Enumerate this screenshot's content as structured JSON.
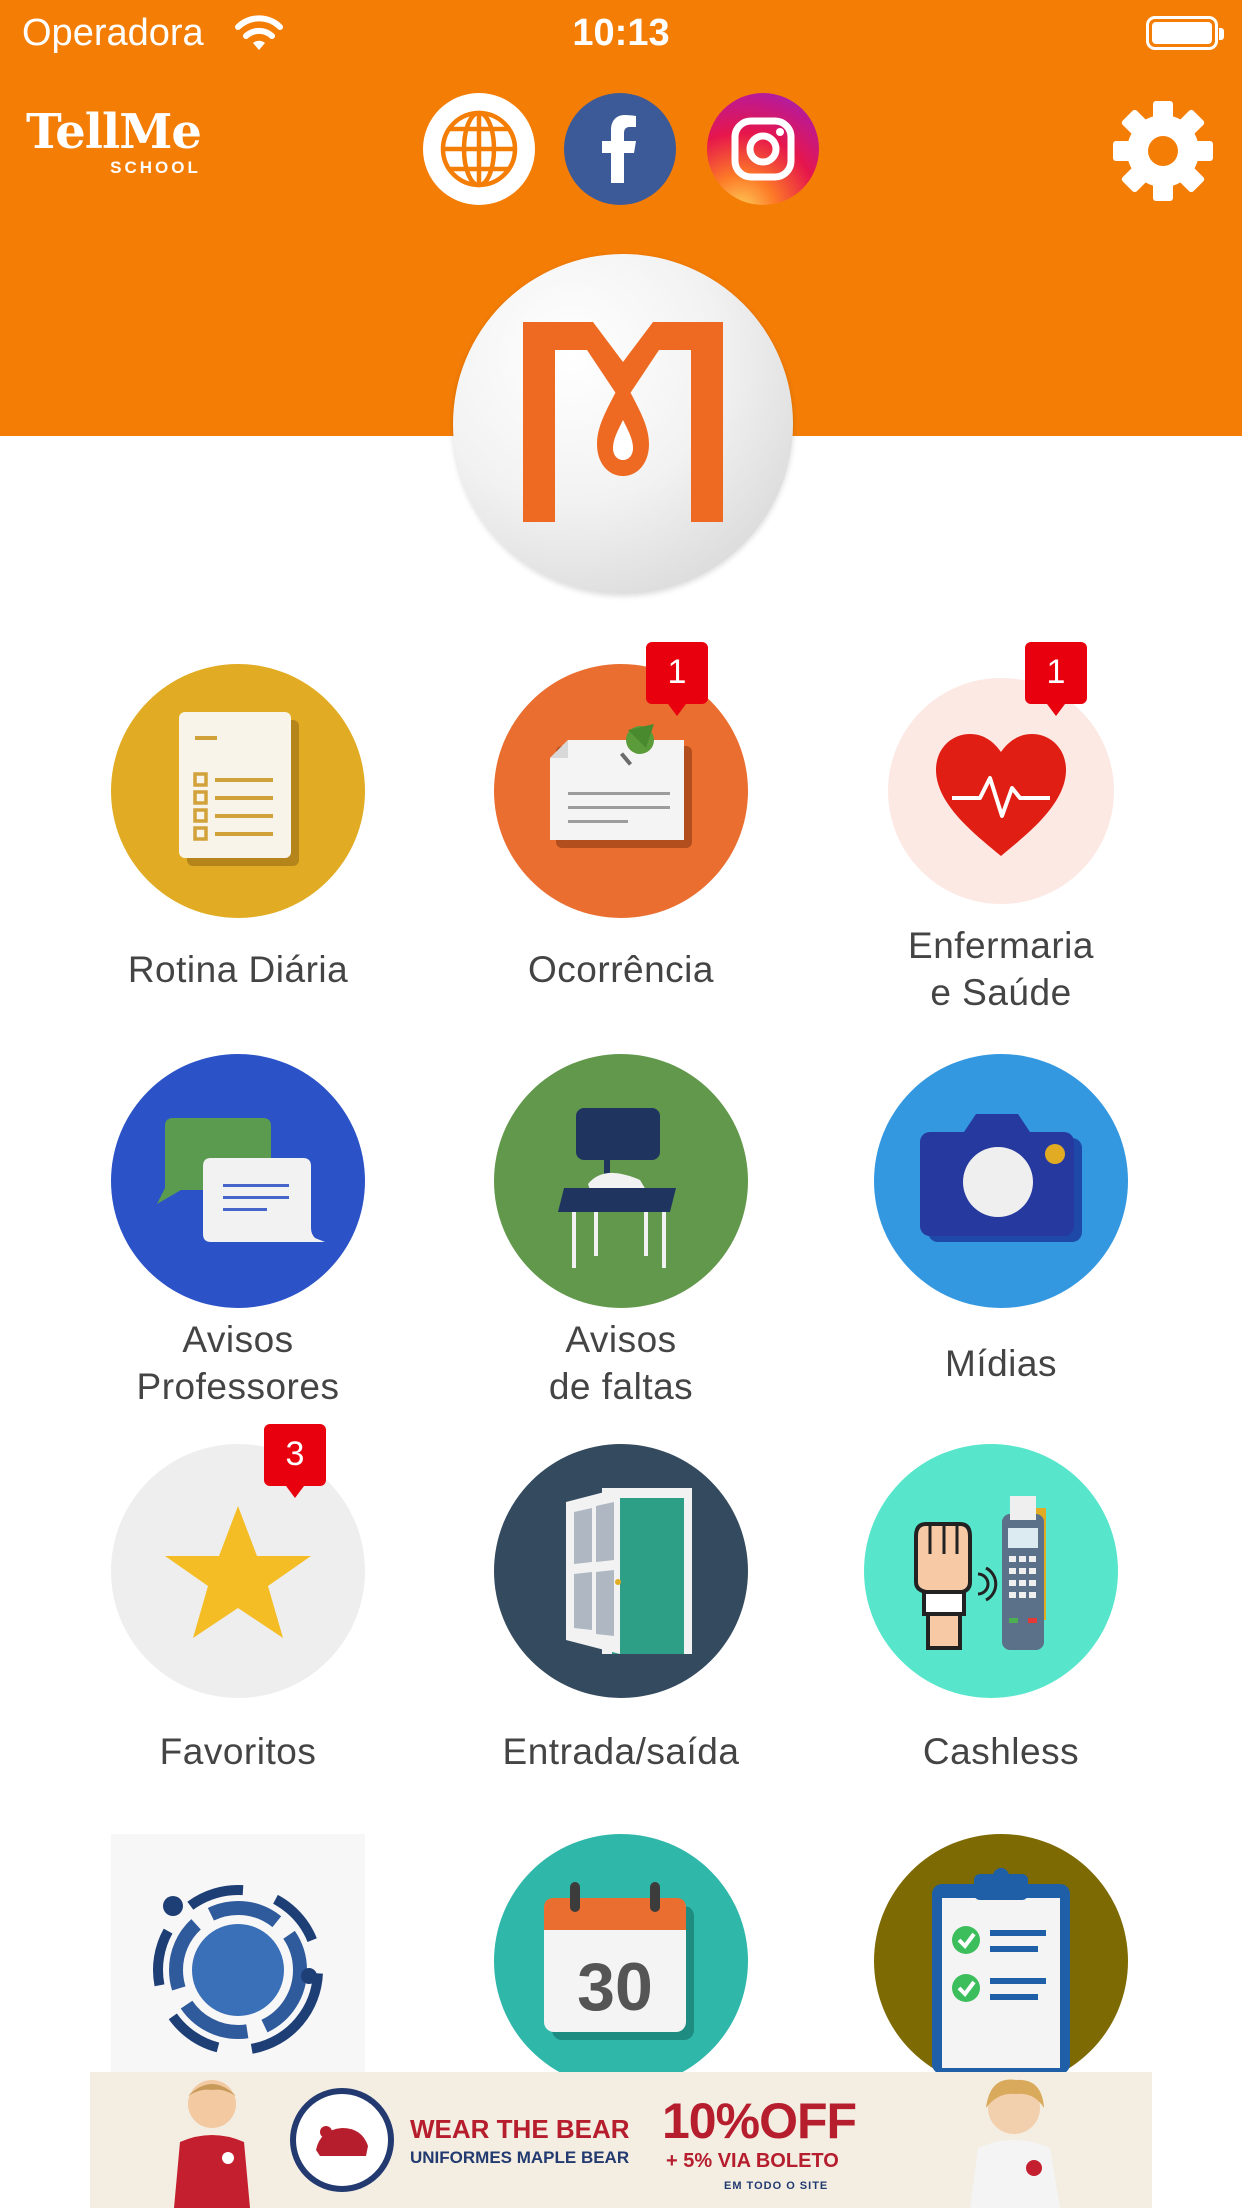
{
  "status_bar": {
    "carrier": "Operadora",
    "time": "10:13"
  },
  "header": {
    "brand_name": "TellMe",
    "brand_sub": "SCHOOL",
    "background_color": "#F47D06",
    "social_links": [
      {
        "name": "website",
        "icon": "globe-icon"
      },
      {
        "name": "facebook",
        "icon": "facebook-icon"
      },
      {
        "name": "instagram",
        "icon": "instagram-icon"
      }
    ],
    "settings_icon": "gear-icon",
    "school_logo": "Maple Bear M logo"
  },
  "tiles": [
    {
      "label_lines": [
        "Rotina Diária"
      ],
      "icon": "checklist-icon",
      "color": "#E1AC23"
    },
    {
      "label_lines": [
        "Ocorrência"
      ],
      "icon": "pinned-note-icon",
      "color": "#E96E30",
      "badge": "1"
    },
    {
      "label_lines": [
        "Enfermaria",
        "e Saúde"
      ],
      "icon": "heart-pulse-icon",
      "color": "#FCE9E4",
      "badge": "1"
    },
    {
      "label_lines": [
        "Avisos",
        "Professores"
      ],
      "icon": "chat-bubbles-icon",
      "color": "#2B53C7"
    },
    {
      "label_lines": [
        "Avisos",
        "de faltas"
      ],
      "icon": "empty-desk-icon",
      "color": "#62984B"
    },
    {
      "label_lines": [
        "Mídias"
      ],
      "icon": "camera-icon",
      "color": "#3498E0"
    },
    {
      "label_lines": [
        "Favoritos"
      ],
      "icon": "star-icon",
      "color": "#EEEEEE",
      "badge": "3"
    },
    {
      "label_lines": [
        "Entrada/saída"
      ],
      "icon": "door-icon",
      "color": "#344A5E"
    },
    {
      "label_lines": [
        "Cashless"
      ],
      "icon": "contactless-payment-icon",
      "color": "#57E6CC"
    },
    {
      "label_lines": [],
      "icon": "circle-logo-icon",
      "color": "#F7F7F7"
    },
    {
      "label_lines": [],
      "icon": "calendar-icon",
      "color": "#2FB7AA",
      "calendar_day": "30"
    },
    {
      "label_lines": [],
      "icon": "clipboard-check-icon",
      "color": "#7D6A02"
    }
  ],
  "ad": {
    "title": "WEAR THE BEAR",
    "subtitle": "UNIFORMES MAPLE BEAR",
    "offer": "10%OFF",
    "offer_detail": "+ 5% VIA BOLETO",
    "offer_note": "EM TODO O SITE",
    "accent": "#B61E2E"
  }
}
